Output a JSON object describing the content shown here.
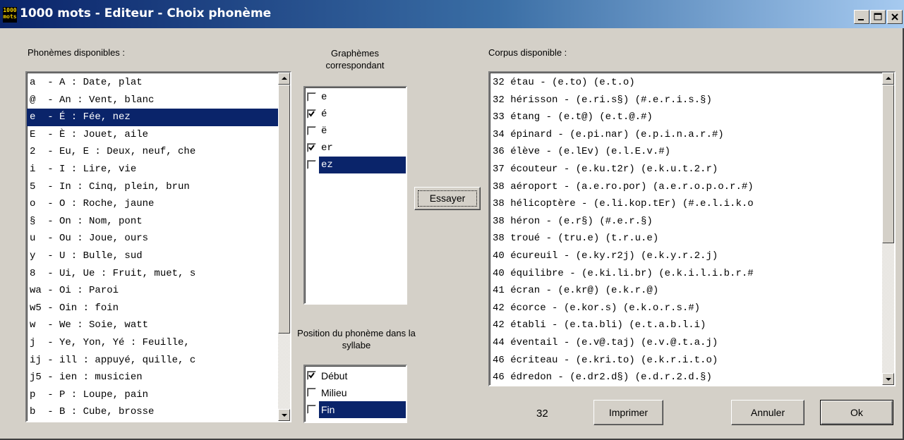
{
  "window": {
    "title": "1000 mots - Editeur - Choix phonème",
    "icon_text_top": "1000",
    "icon_text_bottom": "mots",
    "icon_name": "app-logo-icon"
  },
  "titlebar_buttons": {
    "minimize": "minimize-icon",
    "maximize": "maximize-icon",
    "close": "close-icon"
  },
  "phonemes": {
    "label": "Phonèmes disponibles :",
    "selected_index": 2,
    "items": [
      "a  - A : Date, plat",
      "@  - An : Vent, blanc",
      "e  - É : Fée, nez",
      "E  - È : Jouet, aile",
      "2  - Eu, E : Deux, neuf, che",
      "i  - I : Lire, vie",
      "5  - In : Cinq, plein, brun",
      "o  - O : Roche, jaune",
      "§  - On : Nom, pont",
      "u  - Ou : Joue, ours",
      "y  - U : Bulle, sud",
      "8  - Ui, Ue : Fruit, muet, s",
      "wa - Oi : Paroi",
      "w5 - Oin : foin",
      "w  - We : Soie, watt",
      "j  - Ye, Yon, Yé : Feuille,",
      "ij - ill : appuyé, quille, c",
      "j5 - ien : musicien",
      "p  - P : Loupe, pain",
      "b  - B : Cube, brosse"
    ]
  },
  "graphemes": {
    "label": "Graphèmes correspondant",
    "items": [
      {
        "text": "e",
        "checked": false,
        "selected": false
      },
      {
        "text": "é",
        "checked": true,
        "selected": false
      },
      {
        "text": "ë",
        "checked": false,
        "selected": false
      },
      {
        "text": "er",
        "checked": true,
        "selected": false
      },
      {
        "text": "ez",
        "checked": false,
        "selected": true
      }
    ]
  },
  "try_button": "Essayer",
  "position": {
    "label": "Position du phonème dans la syllabe",
    "items": [
      {
        "text": "Début",
        "checked": true,
        "selected": false
      },
      {
        "text": "Milieu",
        "checked": false,
        "selected": false
      },
      {
        "text": "Fin",
        "checked": false,
        "selected": true
      }
    ]
  },
  "corpus": {
    "label": "Corpus disponible :",
    "items": [
      "32 étau - (e.to) (e.t.o)",
      "32 hérisson - (e.ri.s§) (#.e.r.i.s.§)",
      "33 étang - (e.t@) (e.t.@.#)",
      "34 épinard - (e.pi.nar) (e.p.i.n.a.r.#)",
      "36 élève - (e.lEv) (e.l.E.v.#)",
      "37 écouteur - (e.ku.t2r) (e.k.u.t.2.r)",
      "38 aéroport - (a.e.ro.por) (a.e.r.o.p.o.r.#)",
      "38 hélicoptère - (e.li.kop.tEr) (#.e.l.i.k.o",
      "38 héron - (e.r§) (#.e.r.§)",
      "38 troué - (tru.e) (t.r.u.e)",
      "40 écureuil - (e.ky.r2j) (e.k.y.r.2.j)",
      "40 équilibre - (e.ki.li.br) (e.k.i.l.i.b.r.#",
      "41 écran - (e.kr@) (e.k.r.@)",
      "42 écorce - (e.kor.s) (e.k.o.r.s.#)",
      "42 établi - (e.ta.bli) (e.t.a.b.l.i)",
      "44 éventail - (e.v@.taj) (e.v.@.t.a.j)",
      "46 écriteau - (e.kri.to) (e.k.r.i.t.o)",
      "46 édredon - (e.dr2.d§) (e.d.r.2.d.§)"
    ]
  },
  "count": "32",
  "buttons": {
    "print": "Imprimer",
    "cancel": "Annuler",
    "ok": "Ok"
  }
}
